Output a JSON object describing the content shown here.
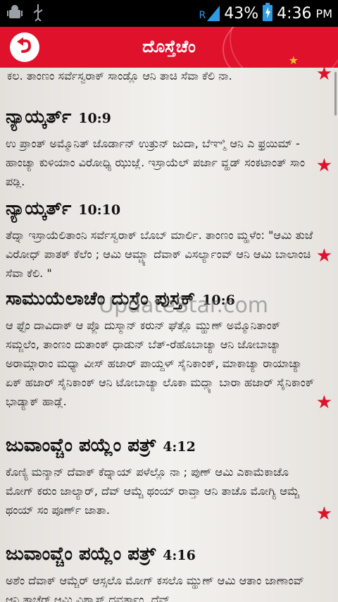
{
  "status": {
    "signal": "R",
    "battery": "43%",
    "time": "4:36",
    "ampm": "PM"
  },
  "header": {
    "title": "ದೊಸ್ತೆಚೆಂ"
  },
  "top_fragment": "ಕಲ. ತಾಂಣಂ ಸರ್ವೆಸ್ವರಾಕ್ ಸಾಂಡ್ಲೊ ಆನಿ ತಾಚಿ ಸೆವಾ ಕೆಲಿ ನಾ.",
  "entries": [
    {
      "book": "ನ್ಯಾಯ್ಕರ್ತ್",
      "ref": "10:9",
      "text": "ಉ ಪ್ರಾಂತ್ ಅಮ್ಮೊನಿತ್ ಜೊರ್ಡಾನ್ ಉತ್ರುನ್ ಜುದಾ, ಬೆಞ್ಮಿ ಆನಿ ಎ ಫ್ರಯಿಮ್ - ಹಾಂಚ್ಯಾ ಕುಳಿಯಾಂ ವಿರೋಧ್ಯಿ ಝುಜ್ಲೆ. ಇಸ್ರಾಯೆಲ್ ಪರ್ಜಾ ವ್ಹಡ್ ಸಂಕಟಾಂತ್ ಸಾಂ ಪಡ್ಲಿ."
    },
    {
      "book": "ನ್ಯಾಯ್ಕರ್ತ್",
      "ref": "10:10",
      "text": "ತೆದ್ನಾ ಇಸ್ರಾಯೆಲಿತಾಂನಿ ಸರ್ವೆಸ್ವರಾಕ್ ಬೊಬ್ ಮಾರ್ಲಿ. ತಾಂಣಂ ಮ್ಹಳೆಂ: \"ಆಮಿ ತುಜೆ ವಿರೋಧ್ ಪಾತಕ್ ಕೆಲೆಂ ; ಆಮಿ ಆಮ್ಚ್ಯಾ ದೆವಾಕ್ ವಿಸರ್ಲ್ಯಾಂವ್ ಆನಿ ಆಮಿ ಬಾಲಾಂಚಿ ಸೆವಾ ಕೆಲಿ. \""
    },
    {
      "book": "ಸಾಮುಯೆಲಾಚೆಂ ದುಸ್ರೆಂ ಪುಸ್ತಕ್",
      "ref": "10:6",
      "text": "ಆ ಫ್ಟೆಂ ದಾವಿದಾಕ್ ಆ ಪ್ಲೊ ದುಸ್ಮಾನ್ ಕರುನ್ ಘೆತ್ಲೊ ಮ್ಹುಣ್ ಅಮ್ಮೊನಿತಾಂಕ್ ಸಮ್ಜಲೆಂ, ತಾಂಣಂ ದುತಾಂಕ್ ಧಾಡುನ್ ಬೆತ್-ರೆಹೊಬಾಚ್ಯಾ ಆನಿ ಜೋಬಾಚ್ಯಾ ಅರಾಮ್ಗಾರಾಂ ಮಧ್ಯಾ ವೀಸ್ ಹಜಾರ್ ಪಾಯ್ದಳ್ ಸೈನಿಕಾಂಕ್, ಮಾಕಾಚ್ಯಾ ರಾಯಾಚ್ಯಾ ಏಕ್ ಹಜಾರ್ ಸೈನಿಕಾಂಕ್ ಆನಿ ಟೋಬಾಚ್ಯಾ ಲೊಕಾ ಮದ್ಲ್ಯಾ ಬಾರಾ ಹಜಾರ್ ಸೈನಿಕಾಂಕ್ ಭಾಡ್ಯಾಕ್ ಹಾಡ್ಲೆ."
    },
    {
      "book": "ಜುವಾಂವ್ಚೆಂ ಪಯ್ಲೆಂ ಪತ್ರ್",
      "ref": "4:12",
      "text": "ಕೊಣ್ಯಿ ಮನ್ಶಾನ್ ದೆವಾಕ್ ಕೆದ್ನಾಯ್ ಪಳೆಲ್ಲೊ ನಾ ; ಪುಣ್ ಆಮಿ ಎಕಾಮೆಕಾಚೊ ಮೋಗ್ ಕರುಂ ಜಾಲ್ಯಾರ್, ದೆವ್ ಆಮ್ಚೆ ಥಂಯ್ ರಾವ್ತಾ ಆನಿ ತಾಚೊ ಮೋಗ್ಯಿ ಆಮ್ಚೆ ಥಂಯ್ ಸಂ ಪೂರ್ಣ್ ಜಾತಾ."
    },
    {
      "book": "ಜುವಾಂವ್ಚೆಂ ಪಯ್ಲೆಂ ಪತ್ರ್",
      "ref": "4:16",
      "text": "ಅಶೆಂ ದೆವಾಕ್ ಆಮ್ಚೆರ್ ಆಸ್ಸಲೊ ಮೋಗ್ ಕಸಲೊ ಮ್ಹುಣ್ ಆಮಿ ಆತಾಂ ಜಾಣಾಂವ್ ಆನಿ ತಾಚೆರ್ ಆಮಿ ವಿಶ್ವಾಸ್ ದವರ್ತಾಂ. ದೆವ್"
    }
  ],
  "watermark": "UpdateStar.com",
  "colors": {
    "accent": "#e0112b",
    "star": "#e0112b",
    "title_star": "#f6c12c"
  }
}
